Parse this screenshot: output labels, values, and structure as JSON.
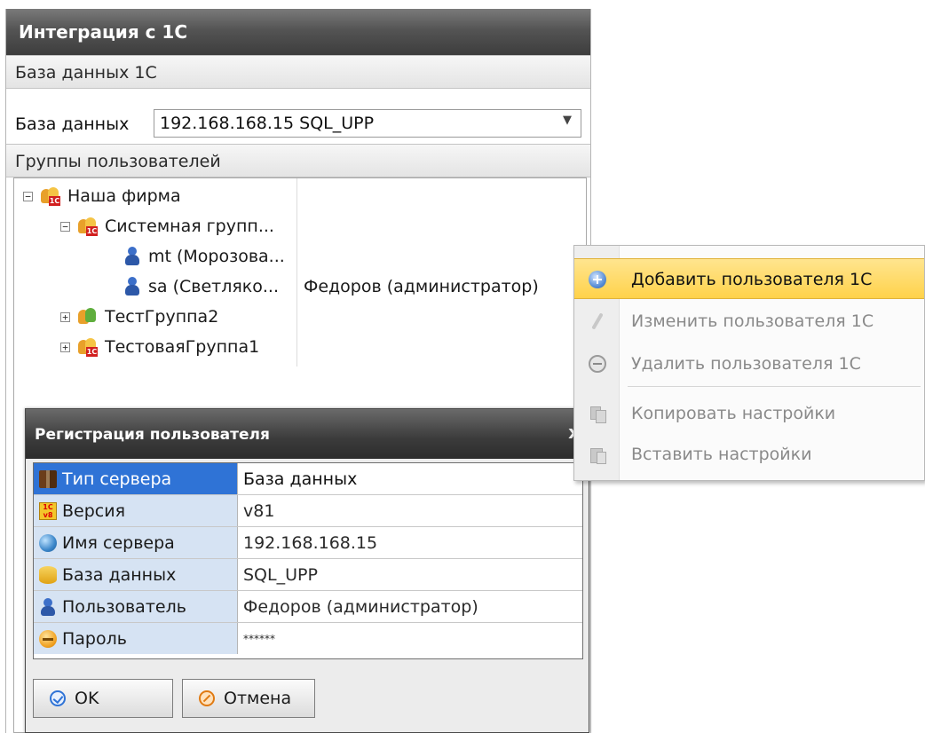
{
  "window": {
    "title": "Интеграция с 1С"
  },
  "db_section": {
    "header": "База данных 1С",
    "label": "База данных",
    "value": "192.168.168.15 SQL_UPP"
  },
  "groups_section": {
    "header": "Группы пользователей",
    "tree": {
      "root": "Наша фирма",
      "system_group": "Системная групп...",
      "user_mt": "mt (Морозова...",
      "user_sa": "sa (Светляко...",
      "group2": "ТестГруппа2",
      "group1": "ТестоваяГруппа1"
    },
    "assigned_user": "Федоров (администратор)"
  },
  "dialog": {
    "title": "Регистрация пользователя",
    "close": "x",
    "rows": [
      {
        "name": "Тип сервера",
        "value": "База данных"
      },
      {
        "name": "Версия",
        "value": "v81"
      },
      {
        "name": "Имя сервера",
        "value": "192.168.168.15"
      },
      {
        "name": "База данных",
        "value": "SQL_UPP"
      },
      {
        "name": "Пользователь",
        "value": "Федоров (администратор)"
      },
      {
        "name": "Пароль",
        "value": "******"
      }
    ],
    "ok_label": "OK",
    "cancel_label": "Отмена"
  },
  "context_menu": {
    "items": [
      {
        "label": "Добавить пользователя 1С"
      },
      {
        "label": "Изменить пользователя 1С"
      },
      {
        "label": "Удалить пользователя 1С"
      },
      {
        "label": "Копировать настройки"
      },
      {
        "label": "Вставить настройки"
      }
    ]
  }
}
